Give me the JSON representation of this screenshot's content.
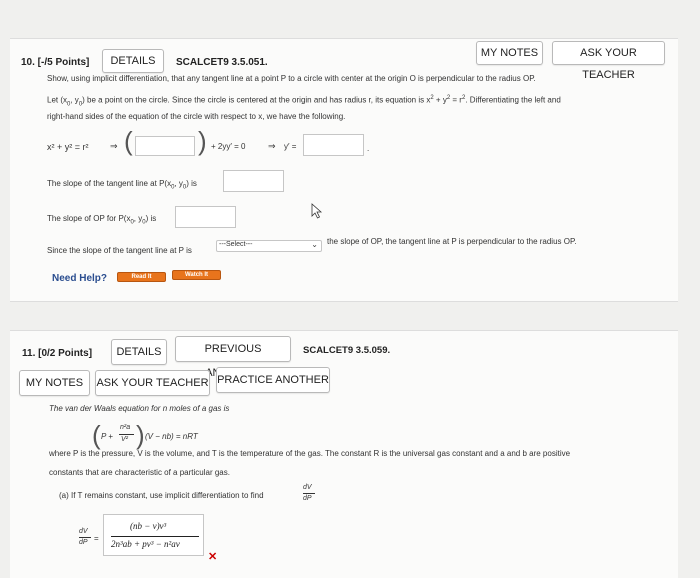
{
  "q10": {
    "number": "10. [-/5 Points]",
    "details_label": "DETAILS",
    "code": "SCALCET9 3.5.051.",
    "my_notes_label": "MY NOTES",
    "ask_teacher_label": "ASK YOUR TEACHER",
    "intro": "Show, using implicit differentiation, that any tangent line at a point P to a circle with center at the origin O is perpendicular to the radius OP.",
    "line2a": "Let (x",
    "line2b": ", y",
    "line2c": ") be a point on the circle. Since the circle is centered at the origin and has radius r, its equation is x",
    "line2d": " + y",
    "line2e": " = r",
    "line2f": ". Differentiating the left and",
    "line3": "right-hand sides of the equation of the circle with respect to x, we have the following.",
    "eq_lhs": "x² + y² = r²",
    "arrow": "⇒",
    "eq_mid": "+ 2yy′ = 0",
    "arrow2": "⇒",
    "eq_y": "y′ =",
    "slope_tangent_a": "The slope of the tangent line at P(x",
    "slope_tangent_b": ", y",
    "slope_tangent_c": ") is",
    "slope_op_a": "The slope of OP for P(x",
    "slope_op_b": ", y",
    "slope_op_c": ") is",
    "since_text": "Since the slope of the tangent line at P is",
    "select_value": "---Select---",
    "since_tail": "the slope of OP, the tangent line at P is perpendicular to the radius OP.",
    "need_help": "Need Help?",
    "read_it": "Read It",
    "watch_it": "Watch It"
  },
  "q11": {
    "number": "11. [0/2 Points]",
    "details_label": "DETAILS",
    "previous_answers_label": "PREVIOUS ANSWERS",
    "code": "SCALCET9 3.5.059.",
    "my_notes_label": "MY NOTES",
    "ask_teacher_label": "ASK YOUR TEACHER",
    "practice_label": "PRACTICE ANOTHER",
    "intro": "The van der Waals equation for n moles of a gas is",
    "eq_P": "P +",
    "eq_num": "n²a",
    "eq_den": "V²",
    "eq_rest": "(V − nb) = nRT",
    "where1": "where P is the pressure, V is the volume, and T is the temperature of the gas. The constant R is the universal gas constant and a and b are positive",
    "where2": "constants that are characteristic of a particular gas.",
    "part_a": "(a)  If T remains constant, use implicit differentiation to find",
    "dv": "dV",
    "dp": "dP",
    "eq_sign": "=",
    "ans_num": "(nb − v)v³",
    "ans_den": "2n³ab + pv³ − n²av",
    "wrong_mark": "✕"
  },
  "colors": {
    "accent_orange": "#e8741c",
    "wrong_red": "#cc0000",
    "help_blue": "#2a4d8f"
  }
}
